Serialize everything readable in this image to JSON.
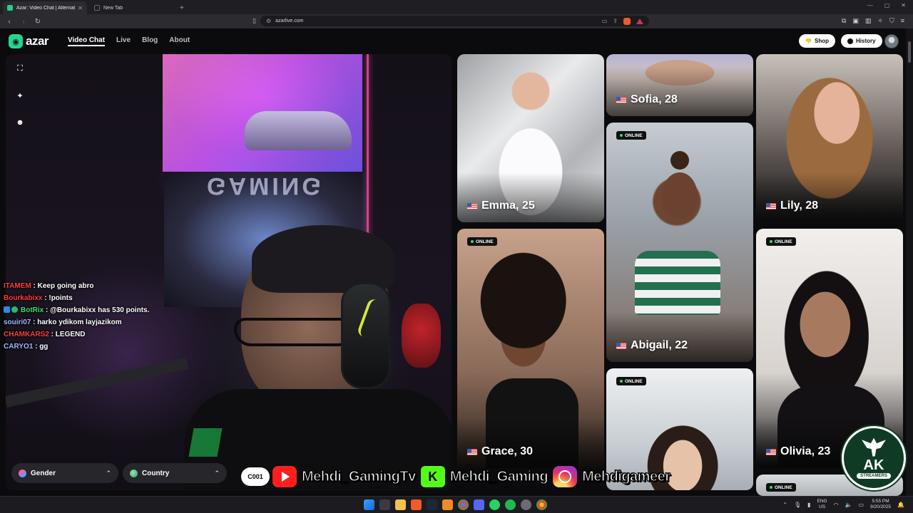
{
  "browser": {
    "tabs": [
      {
        "title": "Azar: Video Chat | Alternative",
        "active": true
      },
      {
        "title": "New Tab",
        "active": false
      }
    ],
    "url": "azarlive.com"
  },
  "header": {
    "logo_text": "azar",
    "nav": [
      "Video Chat",
      "Live",
      "Blog",
      "About"
    ],
    "shop_label": "Shop",
    "history_label": "History"
  },
  "video": {
    "tapestry_text": "GAMING",
    "chat": [
      {
        "user": "ITAMEM",
        "color": "#ff3b3b",
        "message": "Keep going abro",
        "badges": false
      },
      {
        "user": "Bourkabixx",
        "color": "#ff3b3b",
        "message": "!points",
        "badges": false
      },
      {
        "user": "BotRix",
        "color": "#3ee06b",
        "message": "@Bourkabixx has 530 points.",
        "badges": true
      },
      {
        "user": "souiri07",
        "color": "#9db9ff",
        "message": "harko ydikom layjazikom",
        "badges": false
      },
      {
        "user": "CHAMKARS2",
        "color": "#ff3b3b",
        "message": "LEGEND",
        "badges": false
      },
      {
        "user": "CARYO1",
        "color": "#9db9ff",
        "message": "gg",
        "badges": false
      }
    ],
    "filters": {
      "gender": "Gender",
      "country": "Country"
    }
  },
  "profiles": {
    "online_label": "ONLINE",
    "emma": "Emma, 25",
    "sofia": "Sofia, 28",
    "lily": "Lily, 28",
    "abigail": "Abigail, 22",
    "grace": "Grace, 30",
    "olivia": "Olivia, 23"
  },
  "overlay": {
    "start": "C001",
    "youtube": "Mehdi_GamingTv",
    "kick": "Mehdi_Gaming",
    "instagram": "Mehdigameer",
    "kick_letter": "K"
  },
  "badge": {
    "big": "AK",
    "small": "STREAMERS"
  },
  "taskbar": {
    "lang_top": "ENG",
    "lang_bottom": "US",
    "time": "5:55 PM",
    "date": "9/20/2025"
  },
  "colors": {
    "accent": "#25d58c",
    "online_dot": "#2ee07a"
  }
}
